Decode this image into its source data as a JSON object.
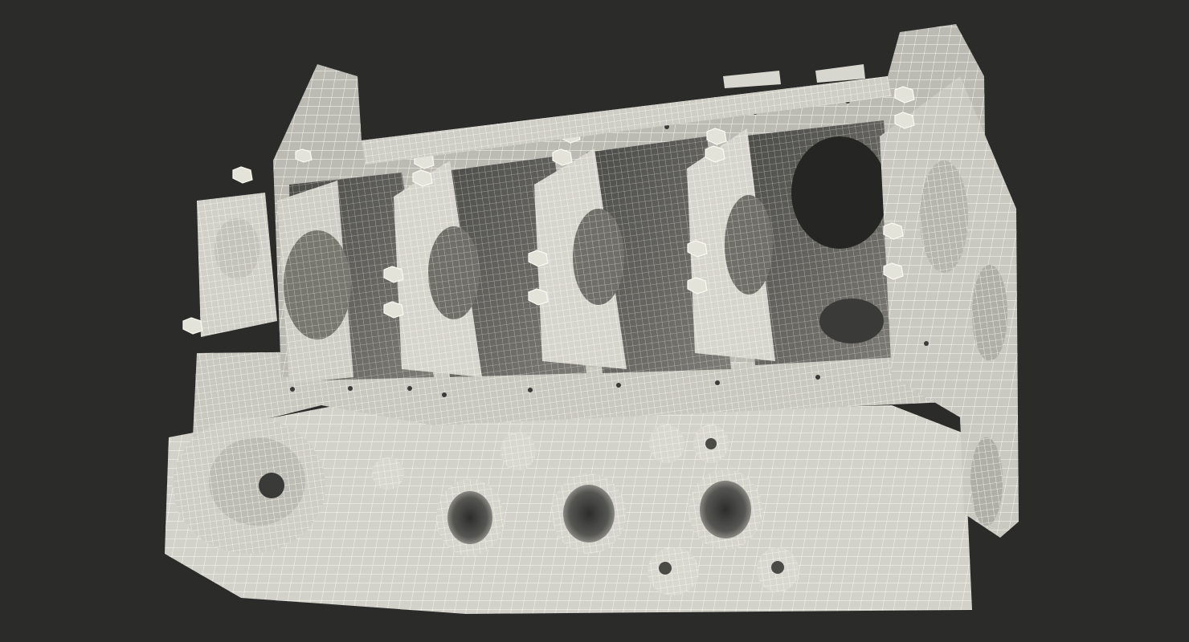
{
  "scene": {
    "subject": "engine-block-wireframe",
    "background_color": "#2b2b2a",
    "surface_color": "#d9d8cf",
    "shadow_color": "#8e8d86",
    "dark_color": "#3a3a38",
    "wire_color": "#fbfaf2"
  }
}
